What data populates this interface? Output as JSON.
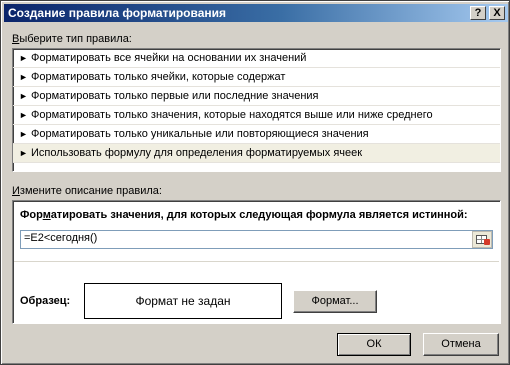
{
  "window": {
    "title": "Создание правила форматирования",
    "help_label": "?",
    "close_label": "X"
  },
  "rule_type": {
    "label_prefix": "В",
    "label_rest": "ыберите тип правила:",
    "items": [
      {
        "label": "Форматировать все ячейки на основании их значений",
        "selected": false
      },
      {
        "label": "Форматировать только ячейки, которые содержат",
        "selected": false
      },
      {
        "label": "Форматировать только первые или последние значения",
        "selected": false
      },
      {
        "label": "Форматировать только значения, которые находятся выше или ниже среднего",
        "selected": false
      },
      {
        "label": "Форматировать только уникальные или повторяющиеся значения",
        "selected": false
      },
      {
        "label": "Использовать формулу для определения форматируемых ячеек",
        "selected": true
      }
    ],
    "arrow_glyph": "►"
  },
  "description": {
    "label_prefix": "И",
    "label_rest": "змените описание правила:",
    "formula_caption_a": "Фор",
    "formula_caption_u": "м",
    "formula_caption_b": "атировать значения, для которых следующая формула является истинной:",
    "formula_value": "=E2<сегодня()",
    "sample_label": "Образец:",
    "sample_text": "Формат не задан",
    "format_button_label": "Формат..."
  },
  "footer": {
    "ok_label": "ОК",
    "cancel_label": "Отмена"
  },
  "colors": {
    "titlebar_start": "#0a246a",
    "titlebar_end": "#a6caf0",
    "dialog_face": "#d4d0c8",
    "selected_row": "#f1efe2"
  }
}
